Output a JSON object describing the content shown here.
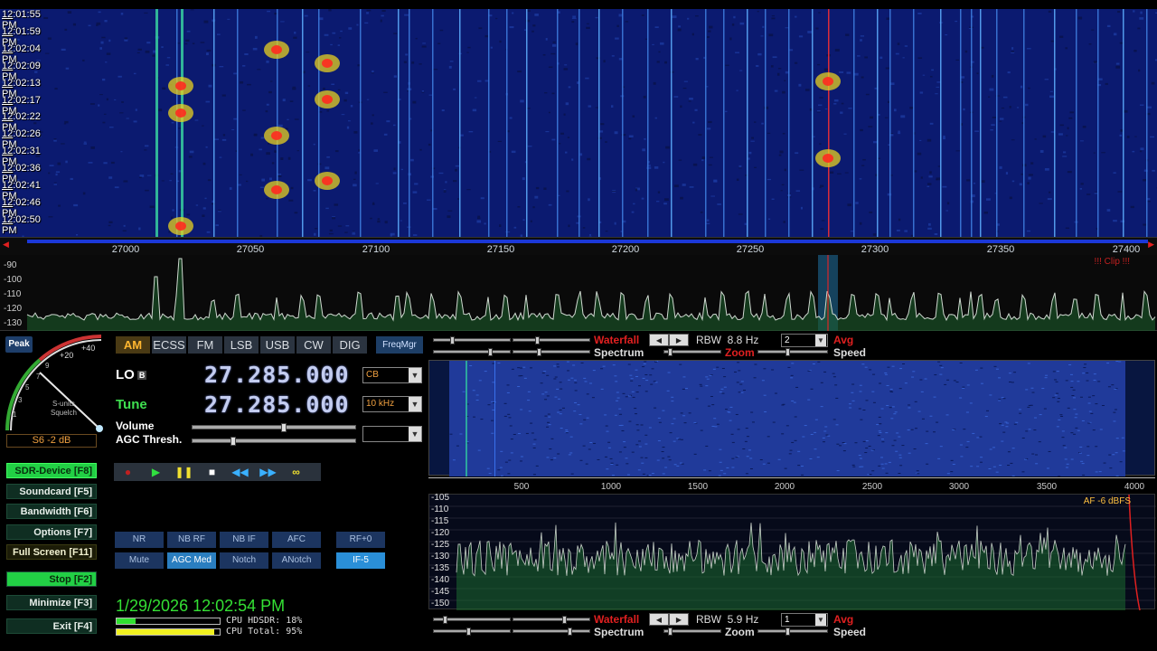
{
  "waterfall": {
    "times": [
      "12:01:55 PM",
      "12:01:59 PM",
      "12:02:04 PM",
      "12:02:09 PM",
      "12:02:13 PM",
      "12:02:17 PM",
      "12:02:22 PM",
      "12:02:26 PM",
      "12:02:31 PM",
      "12:02:36 PM",
      "12:02:41 PM",
      "12:02:46 PM",
      "12:02:50 PM"
    ]
  },
  "ruler": {
    "ticks": [
      "27000",
      "27050",
      "27100",
      "27150",
      "27200",
      "27250",
      "27300",
      "27350",
      "27400"
    ]
  },
  "rf_spectrum": {
    "db_labels": [
      "-90",
      "-100",
      "-110",
      "-120",
      "-130"
    ],
    "clip": "!!! Clip !!!"
  },
  "smeter": {
    "peak_label": "Peak",
    "scale_labels": [
      "+40",
      "+20",
      "9",
      "7",
      "5",
      "3",
      "1"
    ],
    "s_units": "S-units",
    "squelch": "Squelch",
    "readout": "S6 -2 dB"
  },
  "modes": [
    "AM",
    "ECSS",
    "FM",
    "LSB",
    "USB",
    "CW",
    "DIG"
  ],
  "active_mode": "AM",
  "freqmgr": "FreqMgr",
  "lo": {
    "label": "LO",
    "badge": "B",
    "value": "27.285.000",
    "combo": "CB"
  },
  "tune": {
    "label": "Tune",
    "value": "27.285.000",
    "combo": "10 kHz"
  },
  "sliders": {
    "volume": "Volume",
    "agc": "AGC Thresh."
  },
  "side_buttons": {
    "sdr_device": "SDR-Device [F8]",
    "soundcard": "Soundcard [F5]",
    "bandwidth": "Bandwidth [F6]",
    "options": "Options [F7]",
    "full_screen": "Full Screen [F11]",
    "stop": "Stop [F2]",
    "minimize": "Minimize [F3]",
    "exit": "Exit [F4]"
  },
  "func_buttons": {
    "nr": "NR",
    "nb_rf": "NB RF",
    "nb_if": "NB IF",
    "afc": "AFC",
    "rf0": "RF+0",
    "mute": "Mute",
    "agc_med": "AGC Med",
    "notch": "Notch",
    "anotch": "ANotch",
    "if5": "IF-5"
  },
  "status": {
    "datetime": "1/29/2026 12:02:54 PM",
    "cpu_hdsdr": "CPU HDSDR: 18%",
    "cpu_total": "CPU Total: 95%",
    "cpu_hdsdr_level": 0.18,
    "cpu_total_level": 0.95
  },
  "strip_top": {
    "waterfall": "Waterfall",
    "spectrum": "Spectrum",
    "rbw_label": "RBW",
    "rbw": "8.8 Hz",
    "avg_value": "2",
    "avg": "Avg",
    "zoom": "Zoom",
    "speed": "Speed"
  },
  "strip_bottom": {
    "waterfall": "Waterfall",
    "spectrum": "Spectrum",
    "rbw_label": "RBW",
    "rbw": "5.9 Hz",
    "avg_value": "1",
    "avg": "Avg",
    "zoom": "Zoom",
    "speed": "Speed"
  },
  "af_ruler": {
    "ticks": [
      "500",
      "1000",
      "1500",
      "2000",
      "2500",
      "3000",
      "3500",
      "4000"
    ]
  },
  "af_spectrum": {
    "db_labels": [
      "-105",
      "-110",
      "-115",
      "-120",
      "-125",
      "-130",
      "-135",
      "-140",
      "-145",
      "-150"
    ],
    "af_level": "AF -6 dBFS"
  },
  "colors": {
    "accent_green": "#22d045",
    "mode_amber": "#ffb730",
    "waterfall_blue": "#0b1a70",
    "button_blue": "#1c3560"
  }
}
